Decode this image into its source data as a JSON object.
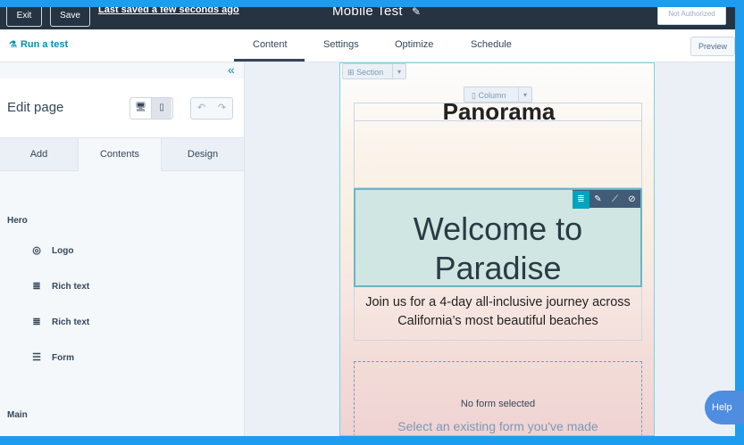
{
  "topbar": {
    "exit_label": "Exit",
    "save_label": "Save",
    "saved_status": "Last saved a few seconds ago",
    "page_title": "Mobile Test",
    "auth_label": "Not Authorized"
  },
  "nav": {
    "run_test": "Run a test",
    "tabs": [
      "Content",
      "Settings",
      "Optimize",
      "Schedule"
    ],
    "active_tab": "Content",
    "preview_label": "Preview"
  },
  "sidebar": {
    "title": "Edit page",
    "subtabs": [
      "Add",
      "Contents",
      "Design"
    ],
    "active_subtab": "Contents",
    "sections": [
      {
        "title": "Hero",
        "modules": [
          {
            "label": "Logo",
            "icon": "logo-icon"
          },
          {
            "label": "Rich text",
            "icon": "rich-text-icon"
          },
          {
            "label": "Rich text",
            "icon": "rich-text-icon"
          },
          {
            "label": "Form",
            "icon": "form-icon"
          }
        ]
      },
      {
        "title": "Main",
        "modules": []
      }
    ]
  },
  "canvas": {
    "section_chip": "Section",
    "column_chip": "Column",
    "heading": "Panorama",
    "hero_text": "Welcome to Paradise",
    "subtext": "Join us for a 4-day all-inclusive journey across California’s most beautiful beaches",
    "form_status": "No form selected",
    "form_prompt": "Select an existing form you've made"
  },
  "help_label": "Help",
  "colors": {
    "frame": "#1e9cf0",
    "topbar": "#253342",
    "accent": "#0091ae",
    "selection": "#6bb5c4"
  }
}
